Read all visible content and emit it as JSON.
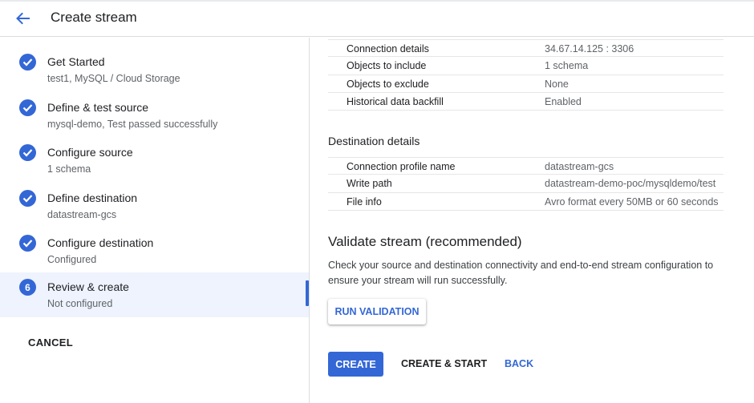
{
  "header": {
    "title": "Create stream"
  },
  "steps": [
    {
      "badge": "",
      "title": "Get Started",
      "subtitle": "test1, MySQL / Cloud Storage",
      "done": true
    },
    {
      "badge": "",
      "title": "Define & test source",
      "subtitle": "mysql-demo, Test passed successfully",
      "done": true
    },
    {
      "badge": "",
      "title": "Configure source",
      "subtitle": "1 schema",
      "done": true
    },
    {
      "badge": "",
      "title": "Define destination",
      "subtitle": "datastream-gcs",
      "done": true
    },
    {
      "badge": "",
      "title": "Configure destination",
      "subtitle": "Configured",
      "done": true
    },
    {
      "badge": "6",
      "title": "Review & create",
      "subtitle": "Not configured",
      "done": false
    }
  ],
  "sidebar": {
    "cancel_label": "CANCEL"
  },
  "source_details": [
    {
      "key": "Connection details",
      "value": "34.67.14.125 : 3306"
    },
    {
      "key": "Objects to include",
      "value": "1 schema"
    },
    {
      "key": "Objects to exclude",
      "value": "None"
    },
    {
      "key": "Historical data backfill",
      "value": "Enabled"
    }
  ],
  "destination": {
    "title": "Destination details",
    "rows": [
      {
        "key": "Connection profile name",
        "value": "datastream-gcs"
      },
      {
        "key": "Write path",
        "value": "datastream-demo-poc/mysqldemo/test"
      },
      {
        "key": "File info",
        "value": "Avro format every 50MB or 60 seconds"
      }
    ]
  },
  "validate": {
    "title": "Validate stream (recommended)",
    "description": "Check your source and destination connectivity and end-to-end stream configuration to ensure your stream will run successfully.",
    "run_label": "RUN VALIDATION"
  },
  "actions": {
    "create_label": "CREATE",
    "create_start_label": "CREATE & START",
    "back_label": "BACK"
  },
  "colors": {
    "accent": "#3367d6",
    "active_step_bg": "#eef3fd"
  }
}
